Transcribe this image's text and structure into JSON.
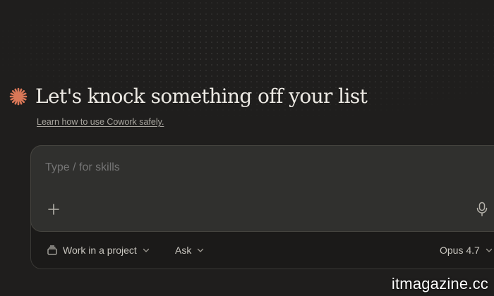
{
  "hero": {
    "title": "Let's knock something off your list",
    "learn_link": "Learn how to use Cowork safely."
  },
  "composer": {
    "placeholder": "Type / for skills"
  },
  "toolbar": {
    "project_label": "Work in a project",
    "mode_label": "Ask",
    "model_label": "Opus 4.7"
  },
  "icons": {
    "logo": "sparkle-icon",
    "attach": "plus-icon",
    "voice": "microphone-icon",
    "project": "folder-stack-icon",
    "dropdown": "chevron-down-icon"
  },
  "colors": {
    "brand_accent": "#d97757",
    "background": "#1f1e1d",
    "input_surface": "#30302e"
  },
  "watermark": "itmagazine.cc"
}
